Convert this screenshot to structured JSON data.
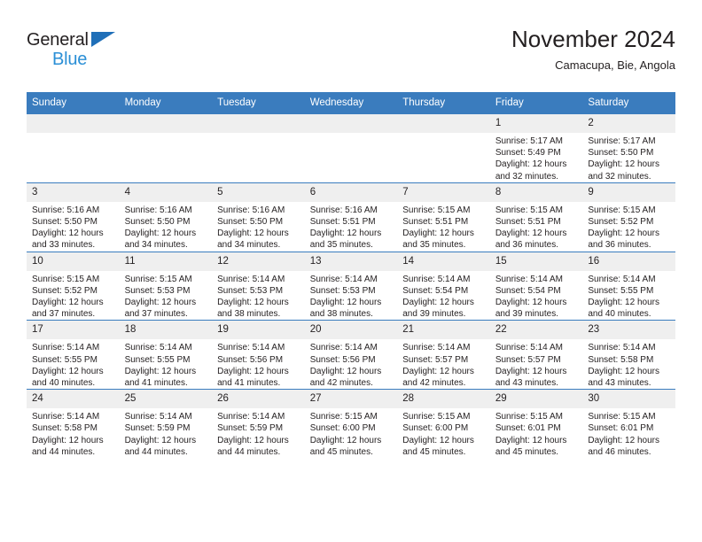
{
  "logo": {
    "word1": "General",
    "word2": "Blue",
    "triangle_color": "#1f6fb8",
    "word2_color": "#2b8fd6"
  },
  "header": {
    "title": "November 2024",
    "subtitle": "Camacupa, Bie, Angola"
  },
  "colors": {
    "header_band": "#3a7cbe",
    "daynum_band": "#efefef",
    "text": "#231f20"
  },
  "weekdays": [
    "Sunday",
    "Monday",
    "Tuesday",
    "Wednesday",
    "Thursday",
    "Friday",
    "Saturday"
  ],
  "weeks": [
    [
      {
        "day": "",
        "lines": []
      },
      {
        "day": "",
        "lines": []
      },
      {
        "day": "",
        "lines": []
      },
      {
        "day": "",
        "lines": []
      },
      {
        "day": "",
        "lines": []
      },
      {
        "day": "1",
        "lines": [
          "Sunrise: 5:17 AM",
          "Sunset: 5:49 PM",
          "Daylight: 12 hours and 32 minutes."
        ]
      },
      {
        "day": "2",
        "lines": [
          "Sunrise: 5:17 AM",
          "Sunset: 5:50 PM",
          "Daylight: 12 hours and 32 minutes."
        ]
      }
    ],
    [
      {
        "day": "3",
        "lines": [
          "Sunrise: 5:16 AM",
          "Sunset: 5:50 PM",
          "Daylight: 12 hours and 33 minutes."
        ]
      },
      {
        "day": "4",
        "lines": [
          "Sunrise: 5:16 AM",
          "Sunset: 5:50 PM",
          "Daylight: 12 hours and 34 minutes."
        ]
      },
      {
        "day": "5",
        "lines": [
          "Sunrise: 5:16 AM",
          "Sunset: 5:50 PM",
          "Daylight: 12 hours and 34 minutes."
        ]
      },
      {
        "day": "6",
        "lines": [
          "Sunrise: 5:16 AM",
          "Sunset: 5:51 PM",
          "Daylight: 12 hours and 35 minutes."
        ]
      },
      {
        "day": "7",
        "lines": [
          "Sunrise: 5:15 AM",
          "Sunset: 5:51 PM",
          "Daylight: 12 hours and 35 minutes."
        ]
      },
      {
        "day": "8",
        "lines": [
          "Sunrise: 5:15 AM",
          "Sunset: 5:51 PM",
          "Daylight: 12 hours and 36 minutes."
        ]
      },
      {
        "day": "9",
        "lines": [
          "Sunrise: 5:15 AM",
          "Sunset: 5:52 PM",
          "Daylight: 12 hours and 36 minutes."
        ]
      }
    ],
    [
      {
        "day": "10",
        "lines": [
          "Sunrise: 5:15 AM",
          "Sunset: 5:52 PM",
          "Daylight: 12 hours and 37 minutes."
        ]
      },
      {
        "day": "11",
        "lines": [
          "Sunrise: 5:15 AM",
          "Sunset: 5:53 PM",
          "Daylight: 12 hours and 37 minutes."
        ]
      },
      {
        "day": "12",
        "lines": [
          "Sunrise: 5:14 AM",
          "Sunset: 5:53 PM",
          "Daylight: 12 hours and 38 minutes."
        ]
      },
      {
        "day": "13",
        "lines": [
          "Sunrise: 5:14 AM",
          "Sunset: 5:53 PM",
          "Daylight: 12 hours and 38 minutes."
        ]
      },
      {
        "day": "14",
        "lines": [
          "Sunrise: 5:14 AM",
          "Sunset: 5:54 PM",
          "Daylight: 12 hours and 39 minutes."
        ]
      },
      {
        "day": "15",
        "lines": [
          "Sunrise: 5:14 AM",
          "Sunset: 5:54 PM",
          "Daylight: 12 hours and 39 minutes."
        ]
      },
      {
        "day": "16",
        "lines": [
          "Sunrise: 5:14 AM",
          "Sunset: 5:55 PM",
          "Daylight: 12 hours and 40 minutes."
        ]
      }
    ],
    [
      {
        "day": "17",
        "lines": [
          "Sunrise: 5:14 AM",
          "Sunset: 5:55 PM",
          "Daylight: 12 hours and 40 minutes."
        ]
      },
      {
        "day": "18",
        "lines": [
          "Sunrise: 5:14 AM",
          "Sunset: 5:55 PM",
          "Daylight: 12 hours and 41 minutes."
        ]
      },
      {
        "day": "19",
        "lines": [
          "Sunrise: 5:14 AM",
          "Sunset: 5:56 PM",
          "Daylight: 12 hours and 41 minutes."
        ]
      },
      {
        "day": "20",
        "lines": [
          "Sunrise: 5:14 AM",
          "Sunset: 5:56 PM",
          "Daylight: 12 hours and 42 minutes."
        ]
      },
      {
        "day": "21",
        "lines": [
          "Sunrise: 5:14 AM",
          "Sunset: 5:57 PM",
          "Daylight: 12 hours and 42 minutes."
        ]
      },
      {
        "day": "22",
        "lines": [
          "Sunrise: 5:14 AM",
          "Sunset: 5:57 PM",
          "Daylight: 12 hours and 43 minutes."
        ]
      },
      {
        "day": "23",
        "lines": [
          "Sunrise: 5:14 AM",
          "Sunset: 5:58 PM",
          "Daylight: 12 hours and 43 minutes."
        ]
      }
    ],
    [
      {
        "day": "24",
        "lines": [
          "Sunrise: 5:14 AM",
          "Sunset: 5:58 PM",
          "Daylight: 12 hours and 44 minutes."
        ]
      },
      {
        "day": "25",
        "lines": [
          "Sunrise: 5:14 AM",
          "Sunset: 5:59 PM",
          "Daylight: 12 hours and 44 minutes."
        ]
      },
      {
        "day": "26",
        "lines": [
          "Sunrise: 5:14 AM",
          "Sunset: 5:59 PM",
          "Daylight: 12 hours and 44 minutes."
        ]
      },
      {
        "day": "27",
        "lines": [
          "Sunrise: 5:15 AM",
          "Sunset: 6:00 PM",
          "Daylight: 12 hours and 45 minutes."
        ]
      },
      {
        "day": "28",
        "lines": [
          "Sunrise: 5:15 AM",
          "Sunset: 6:00 PM",
          "Daylight: 12 hours and 45 minutes."
        ]
      },
      {
        "day": "29",
        "lines": [
          "Sunrise: 5:15 AM",
          "Sunset: 6:01 PM",
          "Daylight: 12 hours and 45 minutes."
        ]
      },
      {
        "day": "30",
        "lines": [
          "Sunrise: 5:15 AM",
          "Sunset: 6:01 PM",
          "Daylight: 12 hours and 46 minutes."
        ]
      }
    ]
  ]
}
